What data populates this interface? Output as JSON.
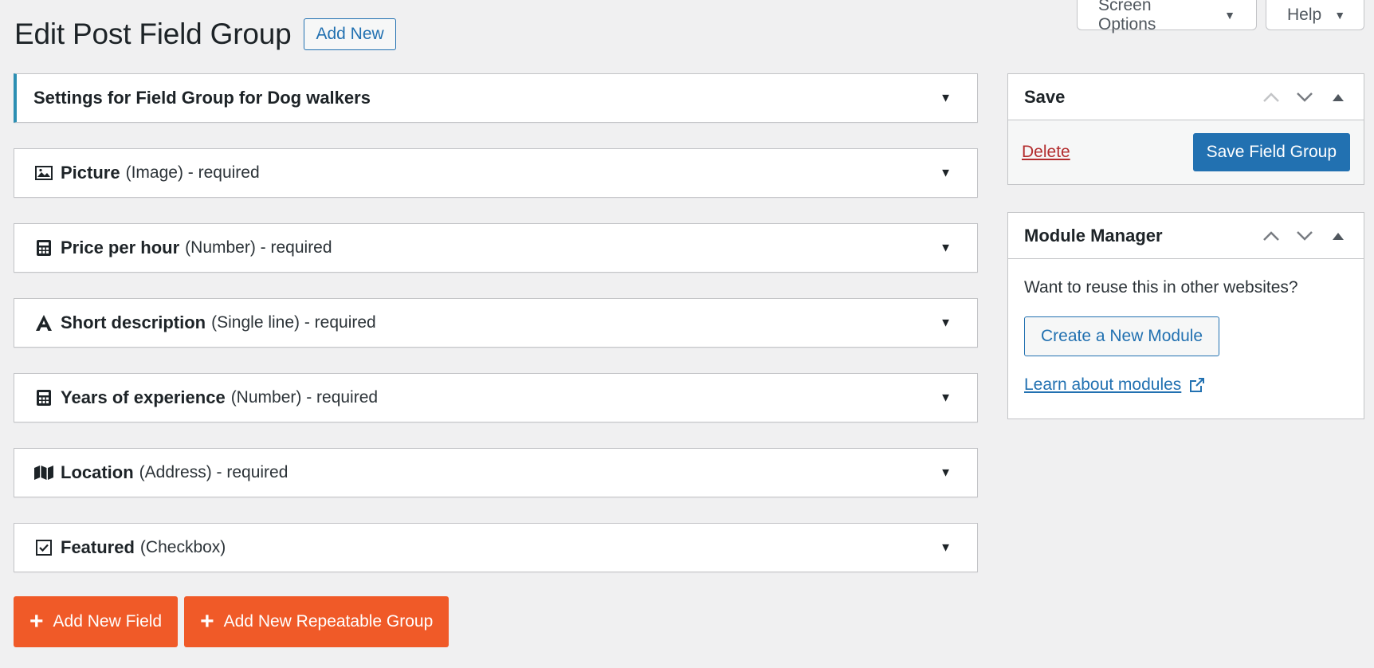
{
  "screen_meta": {
    "screen_options_label": "Screen Options",
    "help_label": "Help"
  },
  "heading": {
    "title": "Edit Post Field Group",
    "add_new_label": "Add New"
  },
  "settings_box": {
    "title": "Settings for Field Group for Dog walkers"
  },
  "fields": [
    {
      "name": "Picture",
      "detail": "(Image) - required",
      "icon": "image-icon"
    },
    {
      "name": "Price per hour",
      "detail": "(Number) - required",
      "icon": "calculator-icon"
    },
    {
      "name": "Short description",
      "detail": "(Single line) - required",
      "icon": "text-icon"
    },
    {
      "name": "Years of experience",
      "detail": "(Number) - required",
      "icon": "calculator-icon"
    },
    {
      "name": "Location",
      "detail": "(Address) - required",
      "icon": "map-icon"
    },
    {
      "name": "Featured",
      "detail": "(Checkbox)",
      "icon": "checkbox-icon"
    }
  ],
  "add_buttons": {
    "add_field": "Add New Field",
    "add_group": "Add New Repeatable Group"
  },
  "save_box": {
    "title": "Save",
    "delete_label": "Delete",
    "save_label": "Save Field Group"
  },
  "module_manager": {
    "title": "Module Manager",
    "text": "Want to reuse this in other websites?",
    "create_label": "Create a New Module",
    "learn_label": "Learn about modules"
  },
  "colors": {
    "accent_blue": "#2271b1",
    "orange": "#f05a28",
    "delete_red": "#b32d2e",
    "settings_border": "#2c8fb3"
  }
}
